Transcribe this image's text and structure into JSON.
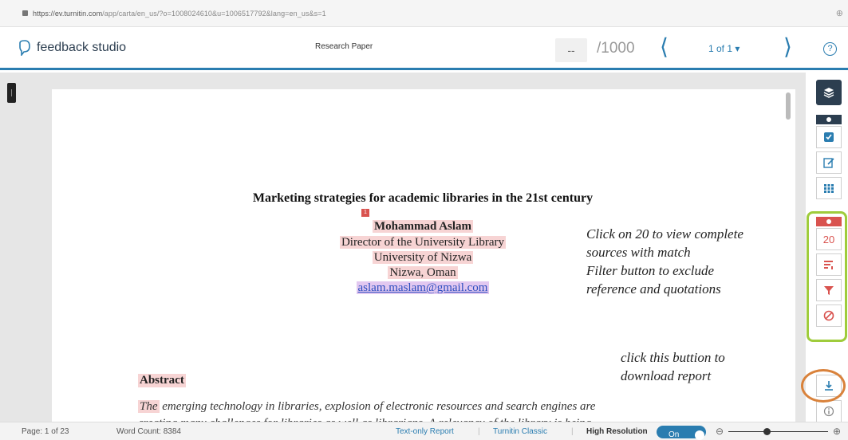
{
  "browser": {
    "url_domain": "https://ev.turnitin.com",
    "url_path": "/app/carta/en_us/?o=1008024610&u=1006517792&lang=en_us&s=1"
  },
  "header": {
    "app_name": "feedback studio",
    "paper_title": "Research Paper",
    "score_value": "--",
    "score_total": "/1000",
    "page_selector": "1 of 1 ▾",
    "help_label": "?"
  },
  "document": {
    "title": "Marketing strategies for academic libraries in the 21st century",
    "match_marker": "1",
    "author": "Mohammad Aslam",
    "position": "Director of the University Library",
    "university": "University of Nizwa",
    "location": "Nizwa, Oman",
    "email": "aslam.maslam@gmail.com",
    "abstract_heading": "Abstract",
    "abstract_first_word": "The",
    "abstract_line1_rest": " emerging technology in libraries, explosion of electronic resources and search engines are",
    "abstract_line2": "creating many challenges for libraries as well as librarians. A relevancy of the library is being"
  },
  "annotations": {
    "sources_note_1": "Click on 20 to view complete",
    "sources_note_2": "sources with match",
    "sources_note_3": "Filter button to exclude",
    "sources_note_4": "reference and quotations",
    "download_note_1": "click this buttion to",
    "download_note_2": "download report"
  },
  "toolbar": {
    "match_count": "20"
  },
  "status_bar": {
    "page": "Page: 1 of 23",
    "word_count": "Word Count: 8384",
    "text_only": "Text-only Report",
    "classic": "Turnitin Classic",
    "high_res": "High Resolution",
    "toggle_state": "On"
  },
  "colors": {
    "brand_blue": "#2a7db0",
    "match_red": "#d9534f",
    "dark_navy": "#2c3e50",
    "annot_green": "#9fcc3c",
    "annot_orange": "#d9823b"
  },
  "zoom_level_fraction": 0.38
}
